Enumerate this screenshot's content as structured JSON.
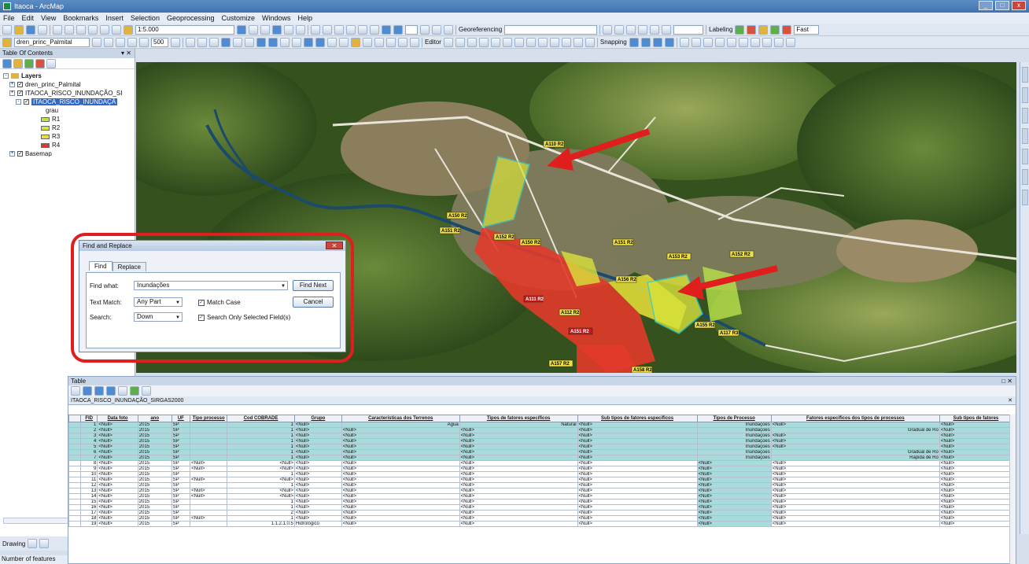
{
  "window": {
    "title": "Itaoca - ArcMap"
  },
  "menu": [
    "File",
    "Edit",
    "View",
    "Bookmarks",
    "Insert",
    "Selection",
    "Geoprocessing",
    "Customize",
    "Windows",
    "Help"
  ],
  "toolbar": {
    "scale": "1:5.000",
    "layer_combo": "dren_princ_Palmital",
    "zoom_value": "500",
    "georeferencing": "Georeferencing",
    "editor": "Editor",
    "snapping": "Snapping",
    "labeling": "Labeling",
    "fast": "Fast"
  },
  "toc": {
    "title": "Table Of Contents",
    "layers_label": "Layers",
    "items": [
      {
        "label": "dren_princ_Palmital"
      },
      {
        "label": "ITAOCA_RISCO_INUNDAÇÃO_SI"
      },
      {
        "label": "ITAOCA_RISCO_INUNDAÇÃ"
      }
    ],
    "field": "grau",
    "legend": [
      {
        "label": "R1",
        "color": "#b9e24a"
      },
      {
        "label": "R2",
        "color": "#d8e23a"
      },
      {
        "label": "R3",
        "color": "#e9df3a"
      },
      {
        "label": "R4",
        "color": "#e23a2a"
      }
    ],
    "basemap": "Basemap"
  },
  "drawing": {
    "label": "Drawing"
  },
  "status": {
    "text": "Number of features"
  },
  "map_labels": [
    "A110 R2",
    "A150 R2",
    "A151 R2",
    "A152 R2",
    "A150 R2",
    "A151 R2",
    "A153 R2",
    "A152 R2",
    "A156 R2",
    "A111 R2",
    "A155 R2",
    "A112 R2",
    "A151 R2",
    "A117 R3",
    "A157 R2",
    "A158 R2"
  ],
  "dialog": {
    "title": "Find and Replace",
    "tab_find": "Find",
    "tab_replace": "Replace",
    "find_what_label": "Find what:",
    "find_what_value": "Inundações",
    "text_match_label": "Text Match:",
    "text_match_value": "Any Part",
    "search_label": "Search:",
    "search_value": "Down",
    "match_case": "Match Case",
    "selected_fields": "Search Only Selected Field(s)",
    "find_next": "Find Next",
    "cancel": "Cancel"
  },
  "table": {
    "title": "Table",
    "layer_tab": "ITAOCA_RISCO_INUNDAÇÃO_SIRGAS2000",
    "columns": [
      "FID",
      "Data foto",
      "ano",
      "UF",
      "Tipo processo",
      "Cod COBRADE",
      "Grupo",
      "Características dos Terrenos",
      "Tipos de fatores específicos",
      "Sub tipos de fatores específicos",
      "Tipos de Processo",
      "Fatores específicos dos tipos de processos",
      "Sub tipos de fatores"
    ],
    "rows": [
      {
        "hl": true,
        "c": [
          "1",
          "<Null>",
          "2015",
          "SP",
          "",
          "1",
          "<Null>",
          "Água",
          "Natural",
          "<Null>",
          "Inundações",
          "<Null>",
          "<Null>"
        ]
      },
      {
        "hl": true,
        "c": [
          "2",
          "<Null>",
          "2015",
          "SP",
          "",
          "1",
          "<Null>",
          "<Null>",
          "<Null>",
          "<Null>",
          "Inundações",
          "Gradual de Ro",
          "<Null>"
        ]
      },
      {
        "hl": true,
        "c": [
          "3",
          "<Null>",
          "2015",
          "SP",
          "",
          "1",
          "<Null>",
          "<Null>",
          "<Null>",
          "<Null>",
          "Inundações",
          "<Null>",
          "<Null>"
        ]
      },
      {
        "hl": true,
        "c": [
          "4",
          "<Null>",
          "2015",
          "SP",
          "",
          "1",
          "<Null>",
          "<Null>",
          "<Null>",
          "<Null>",
          "Inundações",
          "<Null>",
          "<Null>"
        ]
      },
      {
        "hl": true,
        "c": [
          "5",
          "<Null>",
          "2015",
          "SP",
          "",
          "1",
          "<Null>",
          "<Null>",
          "<Null>",
          "<Null>",
          "Inundações",
          "<Null>",
          "<Null>"
        ]
      },
      {
        "hl": true,
        "c": [
          "6",
          "<Null>",
          "2015",
          "SP",
          "",
          "1",
          "<Null>",
          "<Null>",
          "<Null>",
          "<Null>",
          "Inundações",
          "Gradual de Ro",
          "<Null>"
        ]
      },
      {
        "hl": true,
        "c": [
          "7",
          "<Null>",
          "2015",
          "SP",
          "",
          "1",
          "<Null>",
          "<Null>",
          "<Null>",
          "<Null>",
          "Inundações",
          "Rapida de Ro",
          "<Null>"
        ]
      },
      {
        "hl": false,
        "c": [
          "8",
          "<Null>",
          "2015",
          "SP",
          "<Null>",
          "<Null>",
          "<Null>",
          "<Null>",
          "<Null>",
          "<Null>",
          "<Null>",
          "<Null>",
          "<Null>"
        ]
      },
      {
        "hl": false,
        "c": [
          "9",
          "<Null>",
          "2015",
          "SP",
          "<Null>",
          "<Null>",
          "<Null>",
          "<Null>",
          "<Null>",
          "<Null>",
          "<Null>",
          "<Null>",
          "<Null>"
        ]
      },
      {
        "hl": false,
        "c": [
          "10",
          "<Null>",
          "2015",
          "SP",
          "",
          "1",
          "<Null>",
          "<Null>",
          "<Null>",
          "<Null>",
          "<Null>",
          "<Null>",
          "<Null>"
        ]
      },
      {
        "hl": false,
        "c": [
          "11",
          "<Null>",
          "2015",
          "SP",
          "<Null>",
          "<Null>",
          "<Null>",
          "<Null>",
          "<Null>",
          "<Null>",
          "<Null>",
          "<Null>",
          "<Null>"
        ]
      },
      {
        "hl": false,
        "c": [
          "12",
          "<Null>",
          "2015",
          "SP",
          "",
          "1",
          "<Null>",
          "<Null>",
          "<Null>",
          "<Null>",
          "<Null>",
          "<Null>",
          "<Null>"
        ]
      },
      {
        "hl": false,
        "c": [
          "13",
          "<Null>",
          "2015",
          "SP",
          "<Null>",
          "<Null>",
          "<Null>",
          "<Null>",
          "<Null>",
          "<Null>",
          "<Null>",
          "<Null>",
          "<Null>"
        ]
      },
      {
        "hl": false,
        "c": [
          "14",
          "<Null>",
          "2015",
          "SP",
          "<Null>",
          "<Null>",
          "<Null>",
          "<Null>",
          "<Null>",
          "<Null>",
          "<Null>",
          "<Null>",
          "<Null>"
        ]
      },
      {
        "hl": false,
        "c": [
          "15",
          "<Null>",
          "2015",
          "SP",
          "",
          "1",
          "<Null>",
          "<Null>",
          "<Null>",
          "<Null>",
          "<Null>",
          "<Null>",
          "<Null>"
        ]
      },
      {
        "hl": false,
        "c": [
          "16",
          "<Null>",
          "2015",
          "SP",
          "",
          "1",
          "<Null>",
          "<Null>",
          "<Null>",
          "<Null>",
          "<Null>",
          "<Null>",
          "<Null>"
        ]
      },
      {
        "hl": false,
        "c": [
          "17",
          "<Null>",
          "2015",
          "SP",
          "",
          "2",
          "<Null>",
          "<Null>",
          "<Null>",
          "<Null>",
          "<Null>",
          "<Null>",
          "<Null>"
        ]
      },
      {
        "hl": false,
        "c": [
          "18",
          "<Null>",
          "2015",
          "SP",
          "<Null>",
          "1",
          "<Null>",
          "<Null>",
          "<Null>",
          "<Null>",
          "<Null>",
          "<Null>",
          "<Null>"
        ]
      },
      {
        "hl": false,
        "c": [
          "19",
          "<Null>",
          "2015",
          "SP",
          "",
          "1.1.2.1.0.5",
          "Hidrológico",
          "<Null>",
          "<Null>",
          "<Null>",
          "<Null>",
          "<Null>",
          "<Null>"
        ]
      }
    ]
  },
  "colors": {
    "arrow": "#e01e1e",
    "highlight": "#a8dcdc",
    "r4": "#e23a2a",
    "r2": "#d8e23a"
  }
}
